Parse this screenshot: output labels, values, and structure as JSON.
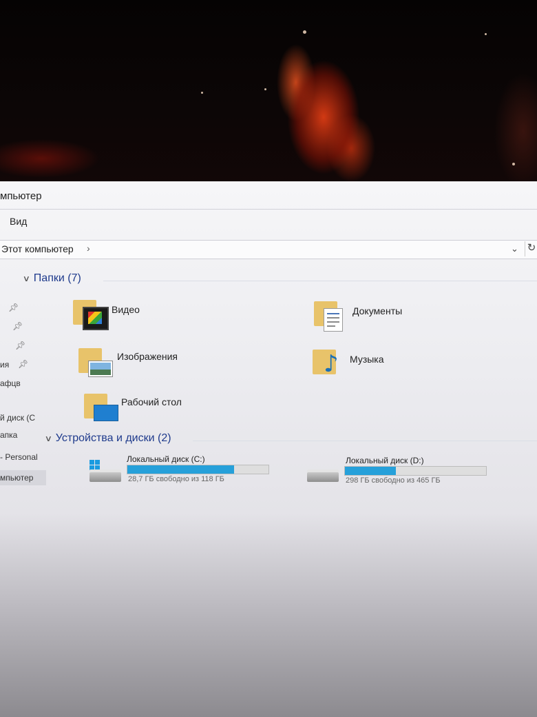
{
  "window": {
    "title": "мпьютер",
    "menu_view": "Вид",
    "address": {
      "crumb": "Этот компьютер",
      "arrow": "›"
    }
  },
  "sidebar": {
    "items": [
      "ия",
      "афцв",
      "й диск (C",
      "апка",
      "- Personal",
      "мпьютер"
    ]
  },
  "folders_section": {
    "header": "Папки (7)",
    "items": [
      {
        "label": "Видео",
        "icon": "video-folder-icon"
      },
      {
        "label": "Документы",
        "icon": "documents-folder-icon"
      },
      {
        "label": "Изображения",
        "icon": "pictures-folder-icon"
      },
      {
        "label": "Музыка",
        "icon": "music-folder-icon"
      },
      {
        "label": "Рабочий стол",
        "icon": "desktop-folder-icon"
      }
    ]
  },
  "devices_section": {
    "header": "Устройства и диски (2)",
    "drives": [
      {
        "name": "Локальный диск (C:)",
        "free_text": "28,7 ГБ свободно из 118 ГБ",
        "used_fraction": 0.757,
        "icon": "windows-drive-icon"
      },
      {
        "name": "Локальный диск (D:)",
        "free_text": "298 ГБ свободно из 465 ГБ",
        "used_fraction": 0.359,
        "icon": "hard-drive-icon"
      }
    ]
  },
  "colors": {
    "accent": "#26a0da",
    "section_header": "#1e3a8c"
  }
}
